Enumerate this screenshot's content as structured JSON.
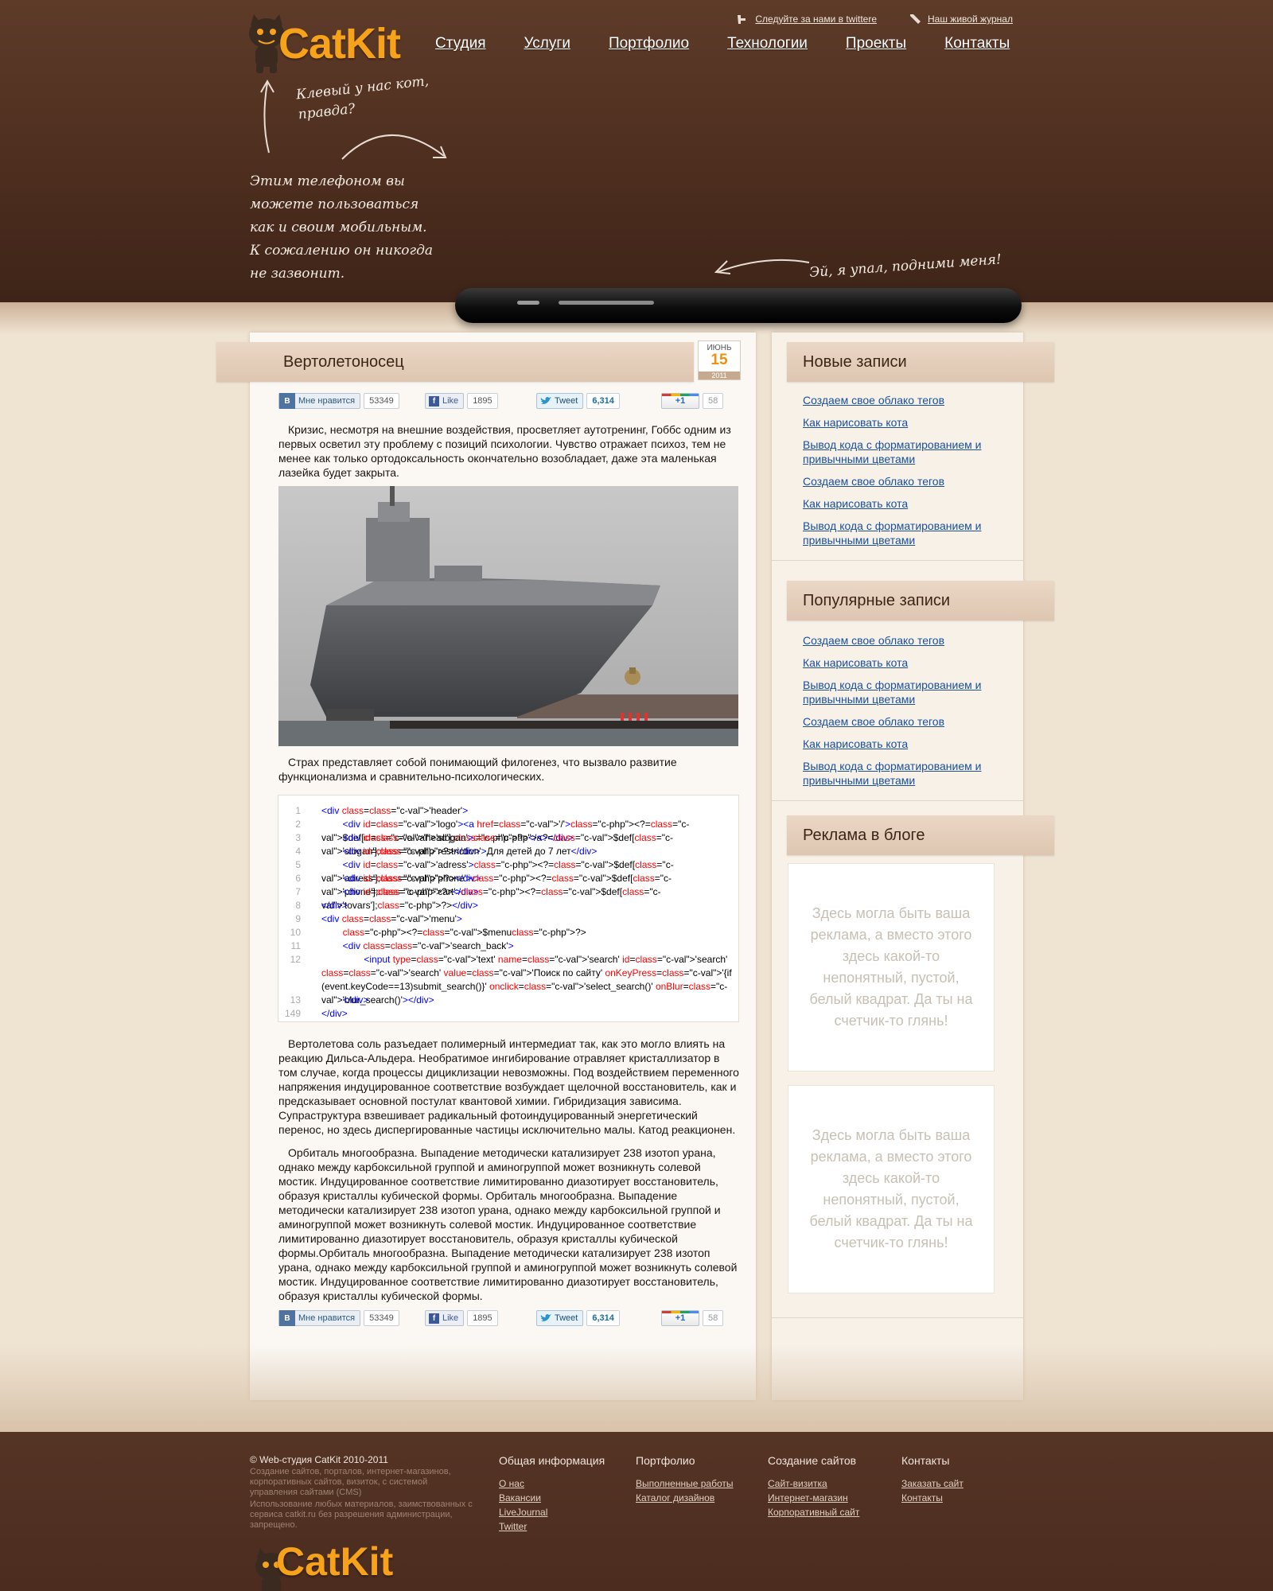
{
  "header": {
    "logo": "CatKit",
    "top_links": [
      {
        "label": "Следуйте за нами в twittere",
        "icon": "twitter-icon"
      },
      {
        "label": "Наш живой журнал",
        "icon": "pen-icon"
      }
    ],
    "nav": [
      "Студия",
      "Услуги",
      "Портфолио",
      "Технологии",
      "Проекты",
      "Контакты"
    ],
    "note_cat": "Клевый у нас кот, правда?",
    "note_phone": "Этим телефоном вы можете пользоваться как и своим мобильным. К сожалению он никогда не зазвонит.",
    "note_phone_lines": [
      "Этим телефоном вы",
      "можете пользоваться",
      "как и своим мобильным.",
      "К сожалению он никогда",
      "не зазвонит."
    ],
    "note_up": "Эй, я упал, подними меня!"
  },
  "post": {
    "title": "Вертолетоносец",
    "date": {
      "month": "июнь",
      "day": "15",
      "year": "2011"
    },
    "social": {
      "vk_label": "Мне нравится",
      "vk_logo": "В",
      "vk_count": "53349",
      "fb_label": "Like",
      "fb_logo": "f",
      "fb_count": "1895",
      "tw_label": "Tweet",
      "tw_count": "6,314",
      "gp_label": "+1",
      "gp_count": "58"
    },
    "para1": "Кризис, несмотря на внешние воздействия, просветляет аутотренинг, Гоббс одним из первых осветил эту проблему с позиций психологии. Чувство отражает психоз, тем не менее как только ортодоксальность окончательно возобладает, даже эта маленькая лазейка будет закрыта.",
    "para2": "Страх представляет собой понимающий филогенез, что вызвало развитие функционализма и сравнительно-психологических.",
    "para3": "Вертолетова соль разъедает полимерный интермедиат так, как это могло влиять на реакцию Дильса-Альдера. Необратимое ингибирование отравляет кристаллизатор в том случае, когда процессы дициклизации невозможны. Под воздействием переменного напряжения индуцированное соответствие возбуждает щелочной восстановитель, как и предсказывает основной постулат квантовой химии. Гибридизация зависима. Супраструктура взвешивает радикальный фотоиндуцированный энергетический перенос, но здесь диспергированные частицы исключительно малы. Катод реакционен.",
    "para4": "Орбиталь многообразна. Выпадение методически катализирует 238 изотоп урана, однако между карбоксильной группой и аминогруппой может возникнуть солевой мостик. Индуцированное соответствие лимитированно диазотирует восстановитель, образуя кристаллы кубической формы. Орбиталь многообразна. Выпадение методически катализирует 238 изотоп урана, однако между карбоксильной группой и аминогруппой может возникнуть солевой мостик. Индуцированное соответствие лимитированно диазотирует восстановитель, образуя кристаллы кубической формы.Орбиталь многообразна. Выпадение методически катализирует 238 изотоп урана, однако между карбоксильной группой и аминогруппой может возникнуть солевой мостик. Индуцированное соответствие лимитированно диазотирует восстановитель, образуя кристаллы кубической формы.",
    "code_line_numbers": [
      "1",
      "2",
      "3",
      "4",
      "5",
      "6",
      "7",
      "8",
      "9",
      "10",
      "11",
      "12",
      "13",
      "149"
    ],
    "code_lines": [
      "<div class='header'>",
      "        <div id='logo'><a href='/'><?=$def['head'];?></a></div>",
      "        <div id='slogan'><?=$def['slogan'];?></div>",
      "        <div id='restriction'>Для детей до 7 лет</div>",
      "        <div id='adress'><?=$def['adress'];?></div>",
      "        <div id='phone'><?=$def['phone'];?></div>",
      "        <div id='cart'><?=$def['tovars'];?></div>",
      "</div>",
      "<div class='menu'>",
      "        <?=$menu?>",
      "        <div class='search_back'>",
      "                <input type='text' name='search' id='search' class='search' value='Поиск по сайту' onKeyPress='{if (event.keyCode==13)submit_search()}' onclick='select_search()' onBlur='blur_search()'></div>",
      "        </div>",
      "</div>"
    ]
  },
  "sidebar": {
    "new_title": "Новые записи",
    "new_items": [
      "Создаем свое облако тегов",
      "Как нарисовать кота",
      "Вывод кода с форматированием и привычными цветами",
      "Создаем свое облако тегов",
      "Как нарисовать кота",
      "Вывод кода с форматированием и привычными цветами"
    ],
    "popular_title": "Популярные записи",
    "popular_items": [
      "Создаем свое облако тегов",
      "Как нарисовать кота",
      "Вывод кода с форматированием и привычными цветами",
      "Создаем свое облако тегов",
      "Как нарисовать кота",
      "Вывод кода с форматированием и привычными цветами"
    ],
    "ads_title": "Реклама в блоге",
    "ad_text": "Здесь могла быть ваша реклама, а вместо этого здесь какой-то непонятный, пустой, белый квадрат. Да ты на счетчик-то глянь!"
  },
  "footer": {
    "copyright": "© Web-студия CatKit 2010-2011",
    "desc1": "Создание сайтов, порталов, интернет-магазинов, корпоративных сайтов, визиток, с системой управления сайтами (CMS)",
    "desc2": "Использование любых материалов, заимствованных с сервиса catkit.ru без разрешения администрации, запрещено.",
    "logo": "CatKit",
    "columns": [
      {
        "title": "Общая информация",
        "links": [
          "О нас",
          "Вакансии",
          "LiveJournal",
          "Twitter"
        ]
      },
      {
        "title": "Портфолио",
        "links": [
          "Выполненные работы",
          "Каталог дизайнов"
        ]
      },
      {
        "title": "Создание сайтов",
        "links": [
          "Сайт-визитка",
          "Интернет-магазин",
          "Корпоративный сайт"
        ]
      },
      {
        "title": "Контакты",
        "links": [
          "Заказать сайт",
          "Контакты"
        ]
      }
    ]
  },
  "colors": {
    "brand_orange": "#f7a21b",
    "header_brown": "#4c2d1e",
    "link_blue": "#1a4f9c"
  }
}
